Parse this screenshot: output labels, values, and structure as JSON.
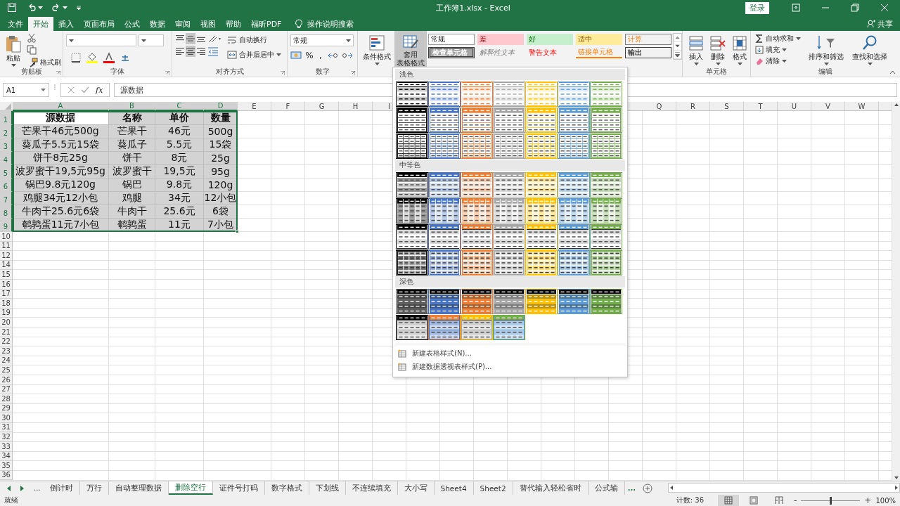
{
  "title_bar": {
    "title": "工作簿1.xlsx  -  Excel",
    "login": "登录"
  },
  "tabs": [
    {
      "label": "文件",
      "selected": false
    },
    {
      "label": "开始",
      "selected": true
    },
    {
      "label": "插入",
      "selected": false
    },
    {
      "label": "页面布局",
      "selected": false
    },
    {
      "label": "公式",
      "selected": false
    },
    {
      "label": "数据",
      "selected": false
    },
    {
      "label": "审阅",
      "selected": false
    },
    {
      "label": "视图",
      "selected": false
    },
    {
      "label": "帮助",
      "selected": false
    },
    {
      "label": "福昕PDF",
      "selected": false
    }
  ],
  "tell_me": "操作说明搜索",
  "share": "共享",
  "ribbon": {
    "clipboard": {
      "paste": "粘贴",
      "format_painter": "格式刷",
      "label": "剪贴板"
    },
    "font": {
      "label": "字体"
    },
    "alignment": {
      "align_buttons": [
        {
          "kind": "top",
          "selected": false
        },
        {
          "kind": "middle",
          "selected": true
        },
        {
          "kind": "bottom",
          "selected": false
        },
        {
          "kind": "left",
          "selected": false
        },
        {
          "kind": "center",
          "selected": true
        },
        {
          "kind": "right",
          "selected": false
        }
      ],
      "wrap": "自动换行",
      "merge": "合并后居中",
      "label": "对齐方式"
    },
    "number": {
      "format": "常规",
      "percent": "%",
      "comma": ",",
      "label": "数字"
    },
    "styles": {
      "conditional": "条件格式",
      "table_format": [
        "套用",
        "表格格式"
      ],
      "table_format_pressed": true,
      "cell_styles": [
        {
          "label": "常规",
          "kind": "normal"
        },
        {
          "label": "差",
          "kind": "bad"
        },
        {
          "label": "好",
          "kind": "good"
        },
        {
          "label": "适中",
          "kind": "neutral"
        },
        {
          "label": "计算",
          "kind": "calculation"
        },
        {
          "label": "检查单元格",
          "kind": "check"
        },
        {
          "label": "解释性文本",
          "kind": "explanatory"
        },
        {
          "label": "警告文本",
          "kind": "warning"
        },
        {
          "label": "链接单元格",
          "kind": "linked"
        },
        {
          "label": "输出",
          "kind": "output"
        }
      ]
    },
    "cells": {
      "buttons": [
        {
          "label": "插入",
          "kind": "insert"
        },
        {
          "label": "删除",
          "kind": "delete"
        },
        {
          "label": "格式",
          "kind": "format"
        }
      ],
      "label": "单元格"
    },
    "editing": {
      "autosum": "自动求和",
      "fill": "填充",
      "clear": "清除",
      "sort": "排序和筛选",
      "find": "查找和选择",
      "label": "编辑"
    }
  },
  "formula_bar": {
    "name_box": "A1",
    "function_button": "fx",
    "formula": "源数据"
  },
  "sheet": {
    "columns": [
      "A",
      "B",
      "C",
      "D",
      "E",
      "F",
      "G",
      "H",
      "I"
    ],
    "columns_right": [
      "Q",
      "R",
      "S",
      "T",
      "U",
      "V",
      "W"
    ],
    "row_numbers": [
      "1",
      "2",
      "3",
      "4",
      "5",
      "6",
      "7",
      "8",
      "9",
      "10",
      "11",
      "12",
      "14",
      "15",
      "16",
      "17",
      "18",
      "19",
      "20",
      "21",
      "22",
      "23",
      "24",
      "25",
      "26",
      "27",
      "28",
      "29",
      "30",
      "31",
      "32",
      "33",
      "34",
      "35",
      "36"
    ],
    "range_selected": true,
    "rows": [
      {
        "bold": true,
        "cells": [
          {
            "text": "源数据",
            "active": true
          },
          {
            "text": "名称",
            "active": false
          },
          {
            "text": "单价",
            "active": false
          },
          {
            "text": "数量",
            "active": false
          }
        ]
      },
      {
        "bold": false,
        "cells": [
          {
            "text": "芒果干46元500g",
            "active": false
          },
          {
            "text": "芒果干",
            "active": false
          },
          {
            "text": "46元",
            "active": false
          },
          {
            "text": "500g",
            "active": false
          }
        ]
      },
      {
        "bold": false,
        "cells": [
          {
            "text": "葵瓜子5.5元15袋",
            "active": false
          },
          {
            "text": "葵瓜子",
            "active": false
          },
          {
            "text": "5.5元",
            "active": false
          },
          {
            "text": "15袋",
            "active": false
          }
        ]
      },
      {
        "bold": false,
        "cells": [
          {
            "text": "饼干8元25g",
            "active": false
          },
          {
            "text": "饼干",
            "active": false
          },
          {
            "text": "8元",
            "active": false
          },
          {
            "text": "25g",
            "active": false
          }
        ]
      },
      {
        "bold": false,
        "cells": [
          {
            "text": "波罗蜜干19,5元95g",
            "active": false
          },
          {
            "text": "波罗蜜干",
            "active": false
          },
          {
            "text": "19,5元",
            "active": false
          },
          {
            "text": "95g",
            "active": false
          }
        ]
      },
      {
        "bold": false,
        "cells": [
          {
            "text": "锅巴9.8元120g",
            "active": false
          },
          {
            "text": "锅巴",
            "active": false
          },
          {
            "text": "9.8元",
            "active": false
          },
          {
            "text": "120g",
            "active": false
          }
        ]
      },
      {
        "bold": false,
        "cells": [
          {
            "text": "鸡腿34元12小包",
            "active": false
          },
          {
            "text": "鸡腿",
            "active": false
          },
          {
            "text": "34元",
            "active": false
          },
          {
            "text": "12小包",
            "active": false
          }
        ]
      },
      {
        "bold": false,
        "cells": [
          {
            "text": "牛肉干25.6元6袋",
            "active": false
          },
          {
            "text": "牛肉干",
            "active": false
          },
          {
            "text": "25.6元",
            "active": false
          },
          {
            "text": "6袋",
            "active": false
          }
        ]
      },
      {
        "bold": false,
        "cells": [
          {
            "text": "鹌鹑蛋11元7小包",
            "active": false
          },
          {
            "text": "鹌鹑蛋",
            "active": false
          },
          {
            "text": "11元",
            "active": false
          },
          {
            "text": "7小包",
            "active": false
          }
        ]
      }
    ]
  },
  "gallery": {
    "sections": [
      {
        "title": "浅色",
        "rows": [
          {
            "kind": "light-banded",
            "swatches": [
              {
                "color": "#000000",
                "selected": false
              },
              {
                "color": "#4472c4",
                "selected": false
              },
              {
                "color": "#ed7d31",
                "selected": false
              },
              {
                "color": "#a5a5a5",
                "selected": false
              },
              {
                "color": "#ffc000",
                "selected": false
              },
              {
                "color": "#5b9bd5",
                "selected": false
              },
              {
                "color": "#70ad47",
                "selected": false
              }
            ]
          },
          {
            "kind": "light-header",
            "swatches": [
              {
                "color": "#000000",
                "selected": false
              },
              {
                "color": "#4472c4",
                "selected": false
              },
              {
                "color": "#ed7d31",
                "selected": false
              },
              {
                "color": "#a5a5a5",
                "selected": false
              },
              {
                "color": "#ffc000",
                "selected": false
              },
              {
                "color": "#5b9bd5",
                "selected": false
              },
              {
                "color": "#70ad47",
                "selected": false
              }
            ]
          },
          {
            "kind": "light-grid",
            "swatches": [
              {
                "color": "#000000",
                "selected": false
              },
              {
                "color": "#4472c4",
                "selected": false
              },
              {
                "color": "#ed7d31",
                "selected": false
              },
              {
                "color": "#a5a5a5",
                "selected": false
              },
              {
                "color": "#ffc000",
                "selected": false
              },
              {
                "color": "#5b9bd5",
                "selected": false
              },
              {
                "color": "#70ad47",
                "selected": false
              }
            ]
          }
        ]
      },
      {
        "title": "中等色",
        "rows": [
          {
            "kind": "medium-banded",
            "swatches": [
              {
                "color": "#000000",
                "selected": false
              },
              {
                "color": "#4472c4",
                "selected": true
              },
              {
                "color": "#ed7d31",
                "selected": false
              },
              {
                "color": "#a5a5a5",
                "selected": false
              },
              {
                "color": "#ffc000",
                "selected": false
              },
              {
                "color": "#5b9bd5",
                "selected": false
              },
              {
                "color": "#70ad47",
                "selected": false
              }
            ]
          },
          {
            "kind": "medium-columns",
            "swatches": [
              {
                "color": "#000000",
                "selected": false
              },
              {
                "color": "#4472c4",
                "selected": false
              },
              {
                "color": "#ed7d31",
                "selected": false
              },
              {
                "color": "#a5a5a5",
                "selected": false
              },
              {
                "color": "#ffc000",
                "selected": false
              },
              {
                "color": "#5b9bd5",
                "selected": false
              },
              {
                "color": "#70ad47",
                "selected": false
              }
            ]
          },
          {
            "kind": "medium-lines",
            "swatches": [
              {
                "color": "#000000",
                "selected": false
              },
              {
                "color": "#4472c4",
                "selected": false
              },
              {
                "color": "#ed7d31",
                "selected": false
              },
              {
                "color": "#a5a5a5",
                "selected": false
              },
              {
                "color": "#ffc000",
                "selected": false
              },
              {
                "color": "#5b9bd5",
                "selected": false
              },
              {
                "color": "#70ad47",
                "selected": false
              }
            ]
          },
          {
            "kind": "medium-grid",
            "swatches": [
              {
                "color": "#000000",
                "selected": false
              },
              {
                "color": "#4472c4",
                "selected": false
              },
              {
                "color": "#ed7d31",
                "selected": false
              },
              {
                "color": "#a5a5a5",
                "selected": false
              },
              {
                "color": "#ffc000",
                "selected": false
              },
              {
                "color": "#5b9bd5",
                "selected": false
              },
              {
                "color": "#70ad47",
                "selected": false
              }
            ]
          }
        ]
      },
      {
        "title": "深色",
        "rows": [
          {
            "kind": "dark-banded",
            "swatches": [
              {
                "color": "#595959",
                "selected": false
              },
              {
                "color": "#4472c4",
                "selected": false
              },
              {
                "color": "#ed7d31",
                "selected": false
              },
              {
                "color": "#a5a5a5",
                "selected": false
              },
              {
                "color": "#ffc000",
                "selected": false
              },
              {
                "color": "#5b9bd5",
                "selected": false
              },
              {
                "color": "#70ad47",
                "selected": false
              }
            ]
          },
          {
            "kind": "dark-header",
            "swatches": [
              {
                "color": "#000000",
                "body": {
                  "color": "#a5a5a5"
                },
                "selected": false
              },
              {
                "color": "#ed7d31",
                "body": {
                  "color": "#4472c4"
                },
                "selected": false
              },
              {
                "color": "#ffc000",
                "body": {
                  "color": "#a5a5a5"
                },
                "selected": false
              },
              {
                "color": "#70ad47",
                "body": {
                  "color": "#5b9bd5"
                },
                "selected": false
              }
            ]
          }
        ]
      }
    ],
    "menu": [
      "新建表格样式(N)...",
      "新建数据透视表样式(P)..."
    ]
  },
  "sheet_tabs": {
    "more_left": "...",
    "tabs": [
      {
        "label": "倒计时",
        "selected": false
      },
      {
        "label": "万行",
        "selected": false
      },
      {
        "label": "自动整理数据",
        "selected": false
      },
      {
        "label": "删除空行",
        "selected": true
      },
      {
        "label": "证件号打码",
        "selected": false
      },
      {
        "label": "数字格式",
        "selected": false
      },
      {
        "label": "下划线",
        "selected": false
      },
      {
        "label": "不连续填充",
        "selected": false
      },
      {
        "label": "大小写",
        "selected": false
      },
      {
        "label": "Sheet4",
        "selected": false
      },
      {
        "label": "Sheet2",
        "selected": false
      },
      {
        "label": "替代输入轻松省时",
        "selected": false
      },
      {
        "label": "公式输",
        "selected": false
      }
    ],
    "more_right": "..."
  },
  "status_bar": {
    "status": "就绪",
    "count": "计数: 36",
    "views": [
      {
        "kind": "normal",
        "selected": true
      },
      {
        "kind": "page-layout",
        "selected": false
      },
      {
        "kind": "page-break",
        "selected": false
      }
    ],
    "zoom_out": "-",
    "zoom": {
      "level": 0.5
    },
    "zoom_in": "+",
    "zoom_label": "100%"
  }
}
